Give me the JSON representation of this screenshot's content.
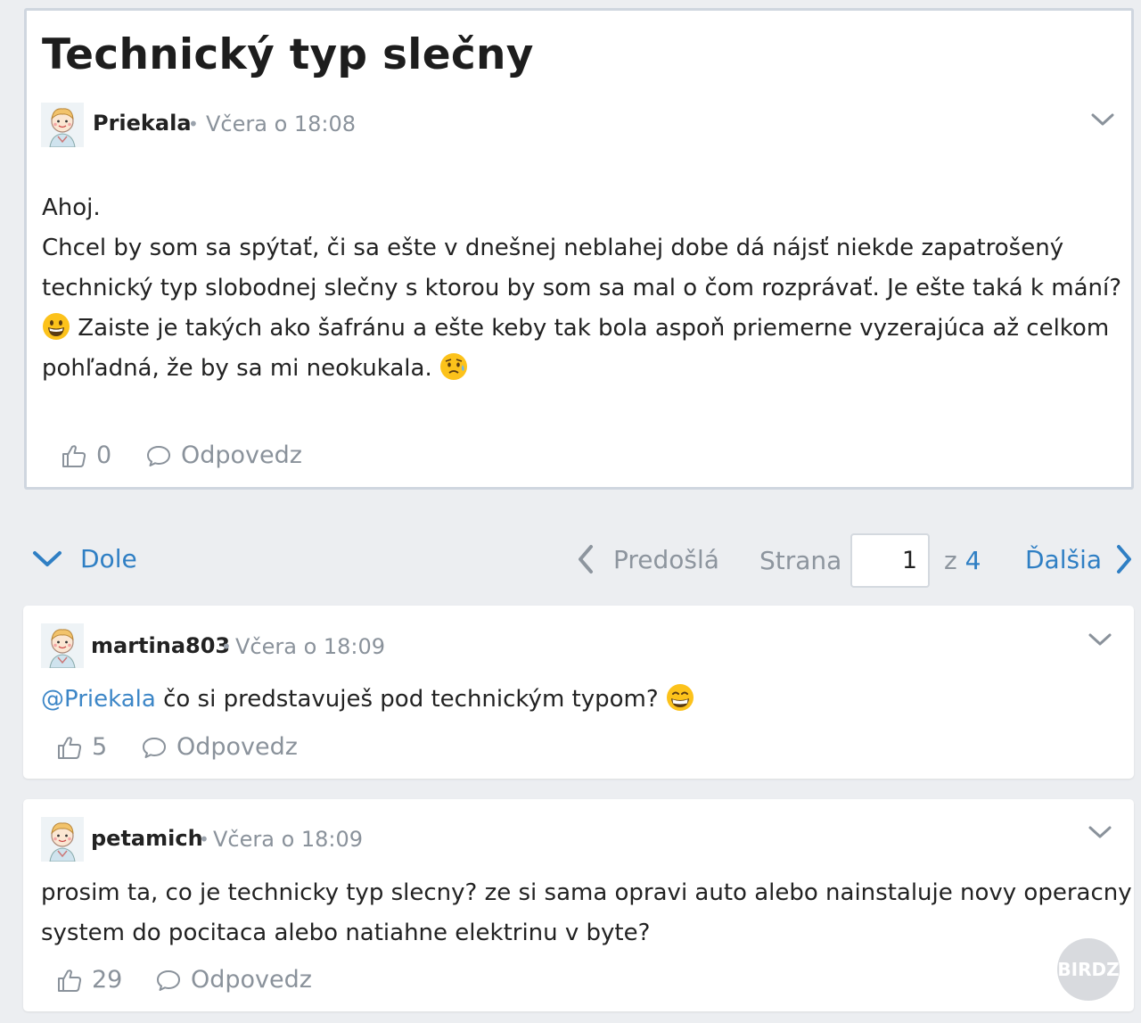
{
  "post": {
    "title": "Technický typ slečny",
    "author": "Priekala",
    "time": "Včera o 18:08",
    "lines": [
      "Ahoj.",
      "Chcel by som sa spýtať, či sa ešte v dnešnej neblahej dobe dá nájsť niekde zapatrošený",
      "technický typ slobodnej slečny s ktorou by som sa mal o čom rozprávať. Je ešte taká k mání?",
      "Zaiste je takých ako šafránu a ešte keby tak bola aspoň priemerne vyzerajúca až celkom",
      "pohľadná, že by sa mi neokukala."
    ],
    "likes": "0",
    "reply_label": "Odpovedz"
  },
  "pager": {
    "down_label": "Dole",
    "prev_label": "Predošlá",
    "page_label": "Strana",
    "page_value": "1",
    "of_label": "z",
    "total_pages": "4",
    "next_label": "Ďalšia"
  },
  "comments": [
    {
      "author": "martina803",
      "time": "Včera o 18:09",
      "mention": "@Priekala",
      "text": " čo si predstavuješ pod technickým typom?",
      "likes": "5",
      "reply_label": "Odpovedz"
    },
    {
      "author": "petamich",
      "time": "Včera o 18:09",
      "lines": [
        "prosim ta, co je technicky typ slecny? ze si sama opravi auto alebo nainstaluje novy operacny",
        "system do pocitaca alebo natiahne elektrinu v byte?"
      ],
      "likes": "29",
      "reply_label": "Odpovedz"
    }
  ],
  "watermark": "BIRDZ",
  "colors": {
    "accent": "#2f7fc4",
    "muted": "#8a929b",
    "background": "#eceef1",
    "card_border": "#cfd6df"
  }
}
